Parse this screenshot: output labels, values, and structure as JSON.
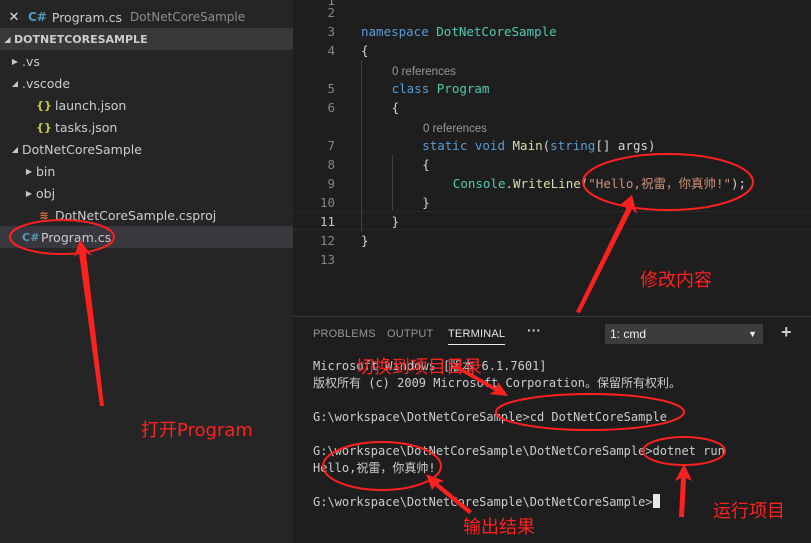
{
  "open_editors": {
    "close_icon": "✕",
    "file_icon": "C#",
    "file": "Program.cs",
    "folder": "DotNetCoreSample"
  },
  "project": {
    "header": "DOTNETCORESAMPLE"
  },
  "tree": [
    {
      "label": ".vs",
      "twisty": "▶",
      "icon": "",
      "indent": 0
    },
    {
      "label": ".vscode",
      "twisty": "◢",
      "icon": "",
      "indent": 0
    },
    {
      "label": "launch.json",
      "twisty": "",
      "icon": "{}",
      "indent": 1
    },
    {
      "label": "tasks.json",
      "twisty": "",
      "icon": "{}",
      "indent": 1
    },
    {
      "label": "DotNetCoreSample",
      "twisty": "◢",
      "icon": "",
      "indent": 0
    },
    {
      "label": "bin",
      "twisty": "▶",
      "icon": "",
      "indent": 1
    },
    {
      "label": "obj",
      "twisty": "▶",
      "icon": "",
      "indent": 1
    },
    {
      "label": "DotNetCoreSample.csproj",
      "twisty": "",
      "icon": "rss",
      "indent": 1
    },
    {
      "label": "Program.cs",
      "twisty": "",
      "icon": "C#",
      "indent": 0,
      "selected": true
    }
  ],
  "editor": {
    "lines": [
      {
        "num": "2"
      },
      {
        "num": "3",
        "indent": 0,
        "tokens": [
          [
            "kw",
            "namespace"
          ],
          [
            "pl",
            " "
          ],
          [
            "ty",
            "DotNetCoreSample"
          ]
        ]
      },
      {
        "num": "4",
        "indent": 0,
        "tokens": [
          [
            "pl",
            "{"
          ]
        ]
      },
      {
        "num": "5",
        "indent": 1,
        "tokens": [
          [
            "kw",
            "class"
          ],
          [
            "pl",
            " "
          ],
          [
            "ty",
            "Program"
          ]
        ]
      },
      {
        "num": "6",
        "indent": 1,
        "tokens": [
          [
            "pl",
            "{"
          ]
        ]
      },
      {
        "num": "7",
        "indent": 2,
        "tokens": [
          [
            "kw",
            "static"
          ],
          [
            "pl",
            " "
          ],
          [
            "kw",
            "void"
          ],
          [
            "pl",
            " "
          ],
          [
            "fn",
            "Main"
          ],
          [
            "pl",
            "("
          ],
          [
            "kw",
            "string"
          ],
          [
            "pl",
            "[] args)"
          ]
        ]
      },
      {
        "num": "8",
        "indent": 2,
        "tokens": [
          [
            "pl",
            "{"
          ]
        ]
      },
      {
        "num": "9",
        "indent": 3,
        "tokens": [
          [
            "ty",
            "Console"
          ],
          [
            "pl",
            "."
          ],
          [
            "fn",
            "WriteLine"
          ],
          [
            "pl",
            "("
          ],
          [
            "st",
            "\"Hello,祝雷，你真帅!\""
          ],
          [
            "pl",
            ");"
          ]
        ]
      },
      {
        "num": "10",
        "indent": 2,
        "tokens": [
          [
            "pl",
            "}"
          ]
        ]
      },
      {
        "num": "11",
        "indent": 1,
        "tokens": [
          [
            "pl",
            "}"
          ]
        ],
        "active": true
      },
      {
        "num": "12",
        "indent": 0,
        "tokens": [
          [
            "pl",
            "}"
          ]
        ]
      },
      {
        "num": "13"
      }
    ],
    "codelens": [
      "0 references",
      "0 references"
    ]
  },
  "panel": {
    "tabs": [
      "PROBLEMS",
      "OUTPUT",
      "TERMINAL"
    ],
    "active_tab": "TERMINAL",
    "more_icon": "···",
    "terminal_select": "1: cmd",
    "add_icon": "+",
    "terminal_lines": [
      "Microsoft Windows [版本 6.1.7601]",
      "版权所有 (c) 2009 Microsoft Corporation。保留所有权利。",
      "",
      "G:\\workspace\\DotNetCoreSample>cd DotNetCoreSample",
      "",
      "G:\\workspace\\DotNetCoreSample\\DotNetCoreSample>dotnet run",
      "Hello,祝雷，你真帅!",
      "",
      "G:\\workspace\\DotNetCoreSample\\DotNetCoreSample>"
    ]
  },
  "annotations": {
    "open_program": "打开Program",
    "modify_content": "修改内容",
    "switch_dir": "切换到项目目录",
    "run_project": "运行项目",
    "output_result": "输出结果"
  },
  "annotation_color": "#ff2020"
}
